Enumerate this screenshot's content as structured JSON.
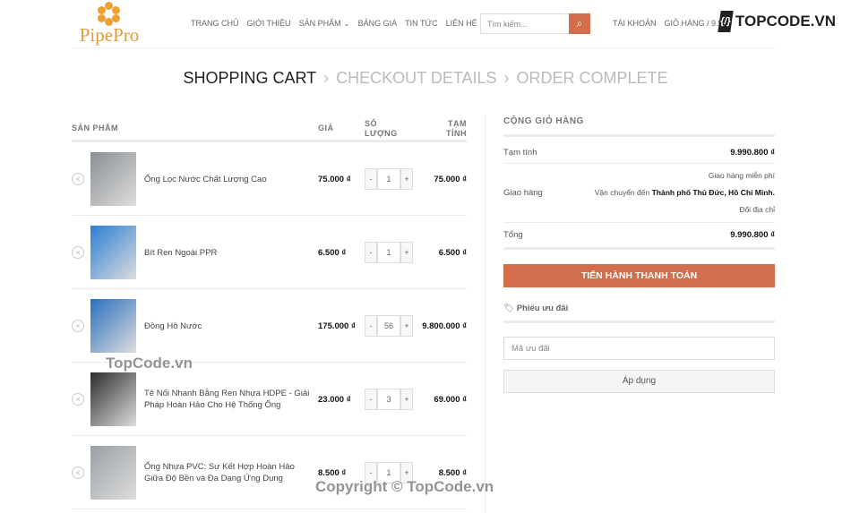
{
  "header": {
    "logo": "PipePro",
    "nav": [
      "TRANG CHỦ",
      "GIỚI THIỆU",
      "SẢN PHẨM",
      "BẢNG GIÁ",
      "TIN TỨC",
      "LIÊN HỆ"
    ],
    "search_placeholder": "Tìm kiếm...",
    "account": "TÀI KHOẢN",
    "cart": "GIỎ HÀNG / 9.9",
    "brand": "TOPCODE.VN"
  },
  "steps": [
    "SHOPPING CART",
    "CHECKOUT DETAILS",
    "ORDER COMPLETE"
  ],
  "table": {
    "headers": {
      "product": "SẢN PHẨM",
      "price": "GIÁ",
      "qty": "SỐ LƯỢNG",
      "subtotal": "TẠM TÍNH"
    },
    "rows": [
      {
        "name": "Ống Lọc Nước Chất Lượng Cao",
        "price": "75.000 ₫",
        "qty": "1",
        "subtotal": "75.000 ₫",
        "color": "#8a8f94"
      },
      {
        "name": "Bít Ren Ngoài PPR",
        "price": "6.500 ₫",
        "qty": "1",
        "subtotal": "6.500 ₫",
        "color": "#2b7fd6"
      },
      {
        "name": "Đồng Hồ Nước",
        "price": "175.000 ₫",
        "qty": "56",
        "subtotal": "9.800.000 ₫",
        "color": "#2a6fc0"
      },
      {
        "name": "Tê Nối Nhanh Bằng Ren Nhựa HDPE - Giải Pháp Hoàn Hảo Cho Hệ Thống Ống",
        "price": "23.000 ₫",
        "qty": "3",
        "subtotal": "69.000 ₫",
        "color": "#2d2d2d"
      },
      {
        "name": "Ống Nhựa PVC: Sự Kết Hợp Hoàn Hảo Giữa Độ Bền và Đa Dạng Ứng Dụng",
        "price": "8.500 ₫",
        "qty": "1",
        "subtotal": "8.500 ₫",
        "color": "#9aa0a6"
      }
    ]
  },
  "totals": {
    "title": "CỘNG GIỎ HÀNG",
    "subtotal_label": "Tạm tính",
    "subtotal": "9.990.800 ₫",
    "shipping_label": "Giao hàng",
    "free": "Giao hàng miễn phí",
    "ship_to": "Vận chuyển đến ",
    "ship_place": "Thành phố Thủ Đức, Hồ Chí Minh.",
    "change": "Đổi địa chỉ",
    "total_label": "Tổng",
    "total": "9.990.800 ₫",
    "checkout": "TIẾN HÀNH THANH TOÁN",
    "coupon_title": "Phiếu ưu đãi",
    "coupon_placeholder": "Mã ưu đãi",
    "apply": "Áp dụng"
  },
  "watermarks": [
    "TopCode.vn",
    "Copyright © TopCode.vn"
  ],
  "accent": "#d26e4b"
}
